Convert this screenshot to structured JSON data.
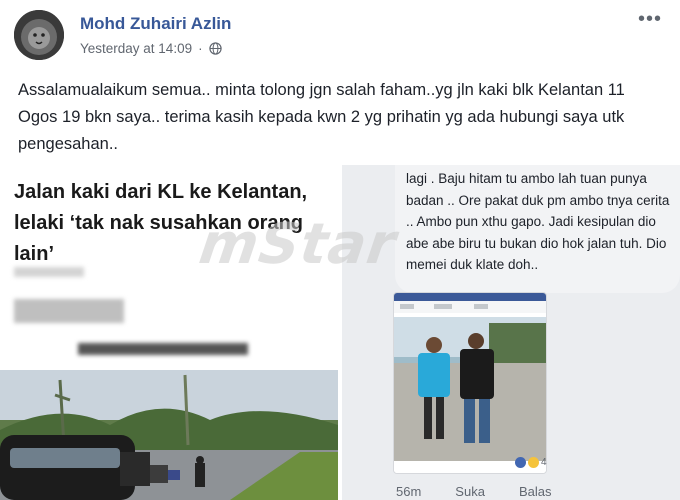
{
  "post": {
    "author": "Mohd Zuhairi Azlin",
    "timestamp": "Yesterday at 14:09",
    "menu_icon": "more-horizontal-icon",
    "text": "Assalamualaikum semua.. minta tolong jgn salah faham..yg jln kaki blk Kelantan 11 Ogos 19 bkn saya.. terima kasih kepada kwn 2 yg prihatin yg ada hubungi saya utk pengesahan.."
  },
  "left_image": {
    "headline": "Jalan kaki dari KL ke Kelantan, lelaki ‘tak nak susahkan orang lain’"
  },
  "right_image": {
    "comment_text": "lagi . Baju hitam tu ambo lah tuan punya badan .. Ore pakat duk pm ambo tnya cerita .. Ambo pun xthu gapo. Jadi kesipulan dio abe abe biru tu bukan dio hok jalan tuh. Dio memei duk klate doh..",
    "reaction_count": "4",
    "comment_time": "56m",
    "like_label": "Suka",
    "reply_label": "Balas"
  },
  "watermark": "mStar",
  "colors": {
    "link": "#385898",
    "meta": "#616770"
  }
}
